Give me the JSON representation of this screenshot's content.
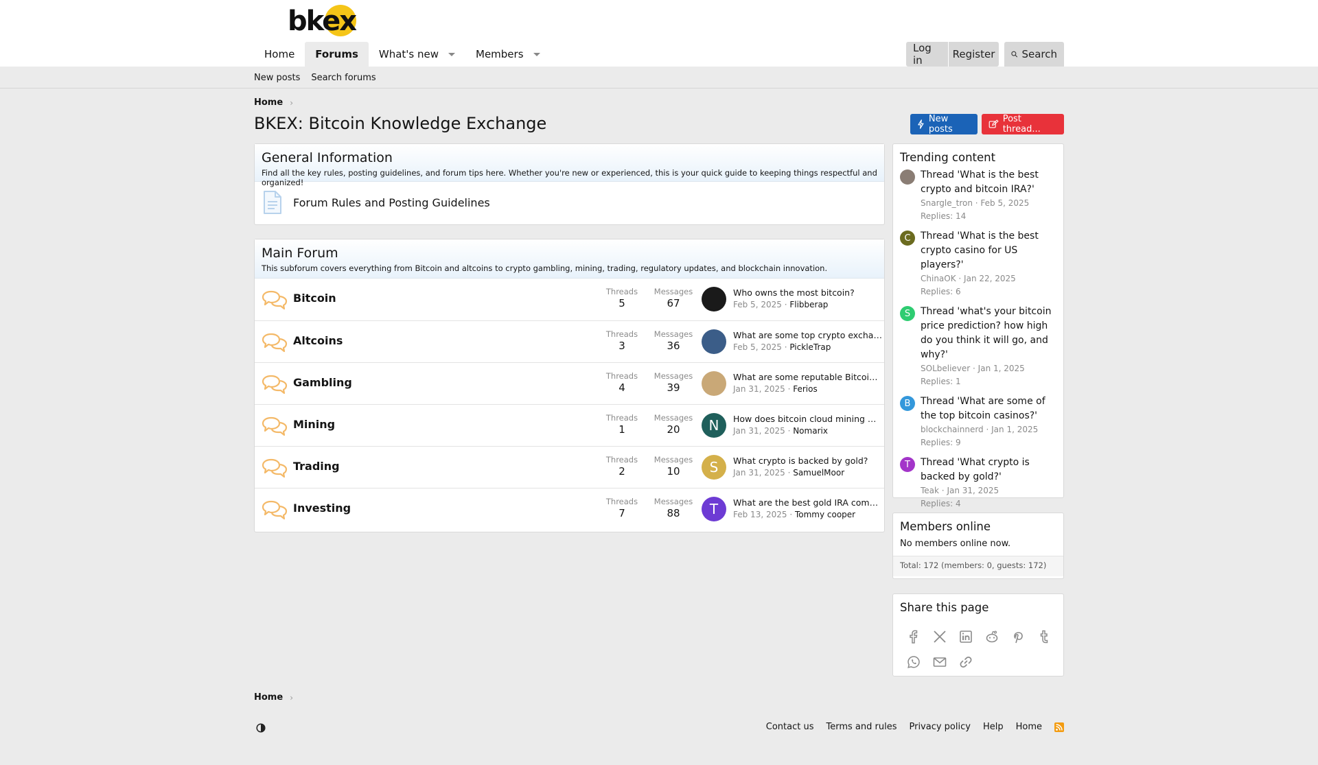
{
  "logo": {
    "text": "bkex"
  },
  "nav": {
    "tabs": [
      {
        "label": "Home"
      },
      {
        "label": "Forums"
      },
      {
        "label": "What's new"
      },
      {
        "label": "Members"
      }
    ],
    "login": "Log in",
    "register": "Register",
    "search": "Search"
  },
  "subnav": {
    "new_posts": "New posts",
    "search_forums": "Search forums"
  },
  "breadcrumb": {
    "home": "Home"
  },
  "page": {
    "title": "BKEX: Bitcoin Knowledge Exchange",
    "new_posts_btn": "New posts",
    "post_thread_btn": "Post thread..."
  },
  "general": {
    "title": "General Information",
    "desc": "Find all the key rules, posting guidelines, and forum tips here. Whether you're new or experienced, this is your quick guide to keeping things respectful and organized!",
    "rules_link": "Forum Rules and Posting Guidelines"
  },
  "main_forum": {
    "title": "Main Forum",
    "desc": "This subforum covers everything from Bitcoin and altcoins to crypto gambling, mining, trading, regulatory updates, and blockchain innovation.",
    "threads_label": "Threads",
    "messages_label": "Messages",
    "nodes": [
      {
        "title": "Bitcoin",
        "threads": "5",
        "messages": "67",
        "latest": "Who owns the most bitcoin?",
        "date": "Feb 5, 2025",
        "user": "Flibberap",
        "avatar": "",
        "avatar_color": "#1a1a1a"
      },
      {
        "title": "Altcoins",
        "threads": "3",
        "messages": "36",
        "latest": "What are some top crypto exchanges...",
        "date": "Feb 5, 2025",
        "user": "PickleTrap",
        "avatar": "",
        "avatar_color": "#3b5d88"
      },
      {
        "title": "Gambling",
        "threads": "4",
        "messages": "39",
        "latest": "What are some reputable Bitcoin roulette...",
        "date": "Jan 31, 2025",
        "user": "Ferios",
        "avatar": "",
        "avatar_color": "#c9a877"
      },
      {
        "title": "Mining",
        "threads": "1",
        "messages": "20",
        "latest": "How does bitcoin cloud mining work...",
        "date": "Jan 31, 2025",
        "user": "Nomarix",
        "avatar": "N",
        "avatar_color": "#1f5f5b"
      },
      {
        "title": "Trading",
        "threads": "2",
        "messages": "10",
        "latest": "What crypto is backed by gold?",
        "date": "Jan 31, 2025",
        "user": "SamuelMoor",
        "avatar": "S",
        "avatar_color": "#d4b04a"
      },
      {
        "title": "Investing",
        "threads": "7",
        "messages": "88",
        "latest": "What are the best gold IRA companies...",
        "date": "Feb 13, 2025",
        "user": "Tommy cooper",
        "avatar": "T",
        "avatar_color": "#6d3bd4"
      }
    ]
  },
  "trending": {
    "title": "Trending content",
    "items": [
      {
        "title": "Thread 'What is the best crypto and bitcoin IRA?'",
        "user": "Snargle_tron",
        "date": "Feb 5, 2025",
        "replies": "Replies: 14",
        "avatar": "",
        "avatar_color": "#8a7d74"
      },
      {
        "title": "Thread 'What is the best crypto casino for US players?'",
        "user": "ChinaOK",
        "date": "Jan 22, 2025",
        "replies": "Replies: 6",
        "avatar": "C",
        "avatar_color": "#6b6b1f"
      },
      {
        "title": "Thread 'what's your bitcoin price prediction? how high do you think it will go, and why?'",
        "user": "SOLbeliever",
        "date": "Jan 1, 2025",
        "replies": "Replies: 1",
        "avatar": "S",
        "avatar_color": "#2ecc71"
      },
      {
        "title": "Thread 'What are some of the top bitcoin casinos?'",
        "user": "blockchainnerd",
        "date": "Jan 1, 2025",
        "replies": "Replies: 9",
        "avatar": "B",
        "avatar_color": "#3498db"
      },
      {
        "title": "Thread 'What crypto is backed by gold?'",
        "user": "Teak",
        "date": "Jan 31, 2025",
        "replies": "Replies: 4",
        "avatar": "T",
        "avatar_color": "#a335c9"
      }
    ]
  },
  "members_online": {
    "title": "Members online",
    "status": "No members online now.",
    "total": "Total: 172 (members: 0, guests: 172)"
  },
  "share": {
    "title": "Share this page",
    "icons": [
      "facebook-icon",
      "x-icon",
      "linkedin-icon",
      "reddit-icon",
      "pinterest-icon",
      "tumblr-icon",
      "whatsapp-icon",
      "email-icon",
      "link-icon"
    ]
  },
  "footer": {
    "home": "Home",
    "links": [
      "Contact us",
      "Terms and rules",
      "Privacy policy",
      "Help",
      "Home"
    ]
  }
}
